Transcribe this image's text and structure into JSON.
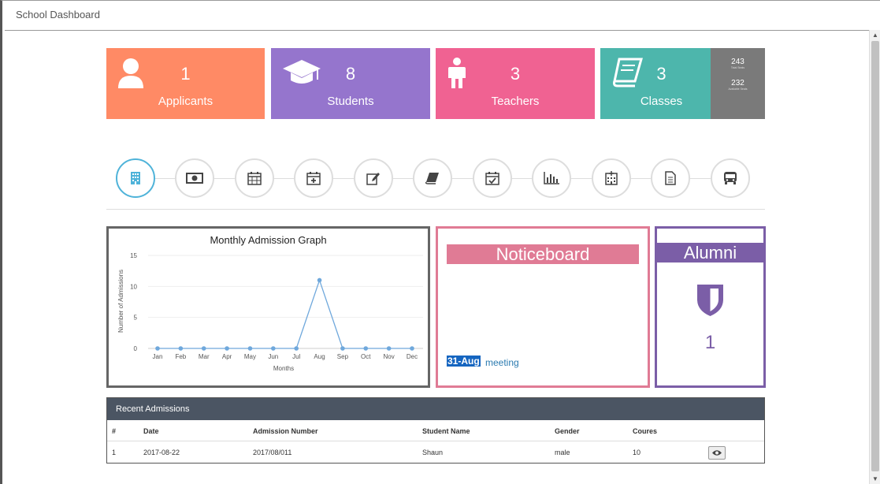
{
  "window": {
    "title": "School Dashboard"
  },
  "stats": {
    "applicants": {
      "count": "1",
      "label": "Applicants",
      "icon": "user-icon",
      "color": "#ff8a65"
    },
    "students": {
      "count": "8",
      "label": "Students",
      "icon": "graduation-cap-icon",
      "color": "#9575cd"
    },
    "teachers": {
      "count": "3",
      "label": "Teachers",
      "icon": "person-icon",
      "color": "#f06292"
    },
    "classes": {
      "count": "3",
      "label": "Classes",
      "icon": "book-icon",
      "color": "#4db6ac"
    },
    "seats": {
      "total": "243",
      "total_label": "Total Seats",
      "available": "232",
      "available_label": "Available Seats"
    }
  },
  "quick_icons": [
    "building-icon",
    "money-icon",
    "calendar-icon",
    "calendar-plus-icon",
    "edit-icon",
    "book-icon",
    "calendar-check-icon",
    "bar-chart-icon",
    "hospital-icon",
    "document-icon",
    "bus-icon"
  ],
  "graph": {
    "title": "Monthly Admission Graph",
    "ylabel": "Number of Admissions",
    "xlabel": "Months"
  },
  "chart_data": {
    "type": "line",
    "title": "Monthly Admission Graph",
    "xlabel": "Months",
    "ylabel": "Number of Admissions",
    "categories": [
      "Jan",
      "Feb",
      "Mar",
      "Apr",
      "May",
      "Jun",
      "Jul",
      "Aug",
      "Sep",
      "Oct",
      "Nov",
      "Dec"
    ],
    "values": [
      0,
      0,
      0,
      0,
      0,
      0,
      0,
      11,
      0,
      0,
      0,
      0
    ],
    "ylim": [
      0,
      15
    ],
    "yticks": [
      0,
      5,
      10,
      15
    ],
    "grid": true,
    "color": "#6fa8dc"
  },
  "noticeboard": {
    "title": "Noticeboard",
    "date": "31-Aug",
    "text": "meeting"
  },
  "alumni": {
    "title": "Alumni",
    "count": "1",
    "icon": "shield-icon"
  },
  "recent_admissions": {
    "title": "Recent Admissions",
    "columns": [
      "#",
      "Date",
      "Admission Number",
      "Student Name",
      "Gender",
      "Coures"
    ],
    "rows": [
      {
        "index": "1",
        "date": "2017-08-22",
        "admission_number": "2017/08/011",
        "student_name": "Shaun",
        "gender": "male",
        "course": "10",
        "action_icon": "eye-icon"
      }
    ]
  }
}
